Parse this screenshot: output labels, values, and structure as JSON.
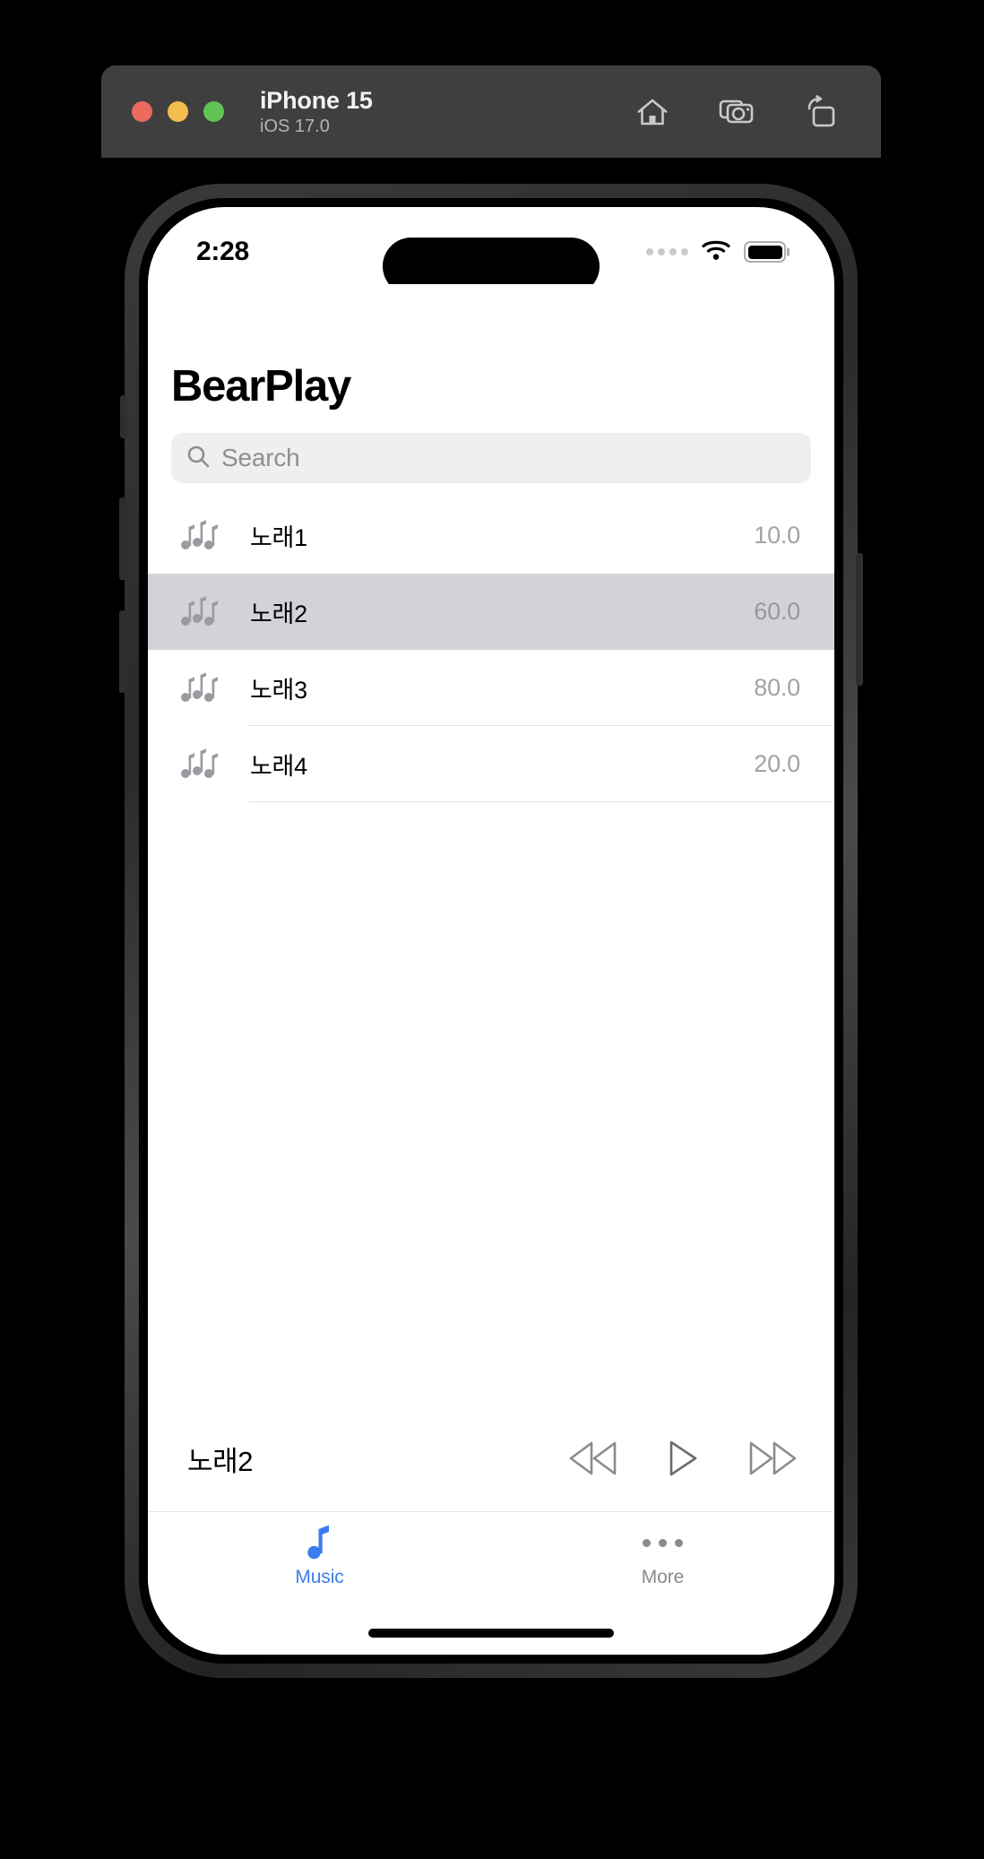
{
  "simulator": {
    "device_name": "iPhone 15",
    "os_version": "iOS 17.0",
    "window_controls": [
      {
        "name": "close",
        "color": "#ec6a5f"
      },
      {
        "name": "minimize",
        "color": "#f4bd4f"
      },
      {
        "name": "zoom",
        "color": "#61c454"
      }
    ],
    "actions": [
      {
        "icon": "home-icon",
        "label": "Home"
      },
      {
        "icon": "screenshot-icon",
        "label": "Screenshot"
      },
      {
        "icon": "rotate-icon",
        "label": "Rotate"
      }
    ]
  },
  "status_bar": {
    "time": "2:28",
    "cellular": "cellular-dots-icon",
    "wifi": "wifi-icon",
    "battery": "battery-icon"
  },
  "app": {
    "title": "BearPlay",
    "search": {
      "placeholder": "Search",
      "value": "",
      "icon": "search-icon"
    },
    "songs": [
      {
        "icon": "music-notes-icon",
        "name": "노래1",
        "value": "10.0",
        "selected": false
      },
      {
        "icon": "music-notes-icon",
        "name": "노래2",
        "value": "60.0",
        "selected": true
      },
      {
        "icon": "music-notes-icon",
        "name": "노래3",
        "value": "80.0",
        "selected": false
      },
      {
        "icon": "music-notes-icon",
        "name": "노래4",
        "value": "20.0",
        "selected": false
      }
    ],
    "now_playing": {
      "title": "노래2",
      "controls": [
        {
          "icon": "rewind-icon",
          "label": "Previous"
        },
        {
          "icon": "play-icon",
          "label": "Play"
        },
        {
          "icon": "fast-forward-icon",
          "label": "Next"
        }
      ]
    },
    "tabs": [
      {
        "label": "Music",
        "icon": "music-note-icon",
        "active": true
      },
      {
        "label": "More",
        "icon": "ellipsis-icon",
        "active": false
      }
    ],
    "colors": {
      "accent": "#3b7ced",
      "selected_row": "#d2d2d7",
      "secondary_text": "#a2a2a8",
      "search_bg": "#efeff0"
    }
  }
}
